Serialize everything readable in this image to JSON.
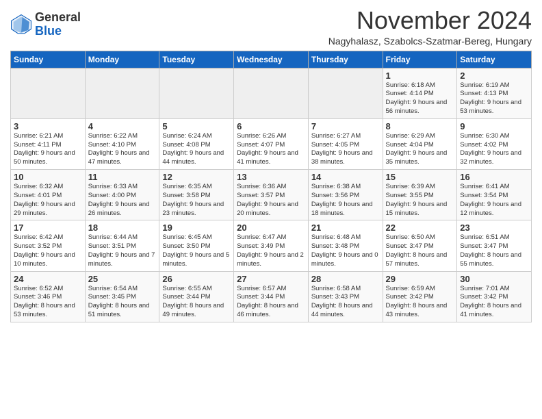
{
  "header": {
    "logo_general": "General",
    "logo_blue": "Blue",
    "month_title": "November 2024",
    "subtitle": "Nagyhalasz, Szabolcs-Szatmar-Bereg, Hungary"
  },
  "weekdays": [
    "Sunday",
    "Monday",
    "Tuesday",
    "Wednesday",
    "Thursday",
    "Friday",
    "Saturday"
  ],
  "weeks": [
    [
      {
        "day": "",
        "info": ""
      },
      {
        "day": "",
        "info": ""
      },
      {
        "day": "",
        "info": ""
      },
      {
        "day": "",
        "info": ""
      },
      {
        "day": "",
        "info": ""
      },
      {
        "day": "1",
        "info": "Sunrise: 6:18 AM\nSunset: 4:14 PM\nDaylight: 9 hours and 56 minutes."
      },
      {
        "day": "2",
        "info": "Sunrise: 6:19 AM\nSunset: 4:13 PM\nDaylight: 9 hours and 53 minutes."
      }
    ],
    [
      {
        "day": "3",
        "info": "Sunrise: 6:21 AM\nSunset: 4:11 PM\nDaylight: 9 hours and 50 minutes."
      },
      {
        "day": "4",
        "info": "Sunrise: 6:22 AM\nSunset: 4:10 PM\nDaylight: 9 hours and 47 minutes."
      },
      {
        "day": "5",
        "info": "Sunrise: 6:24 AM\nSunset: 4:08 PM\nDaylight: 9 hours and 44 minutes."
      },
      {
        "day": "6",
        "info": "Sunrise: 6:26 AM\nSunset: 4:07 PM\nDaylight: 9 hours and 41 minutes."
      },
      {
        "day": "7",
        "info": "Sunrise: 6:27 AM\nSunset: 4:05 PM\nDaylight: 9 hours and 38 minutes."
      },
      {
        "day": "8",
        "info": "Sunrise: 6:29 AM\nSunset: 4:04 PM\nDaylight: 9 hours and 35 minutes."
      },
      {
        "day": "9",
        "info": "Sunrise: 6:30 AM\nSunset: 4:02 PM\nDaylight: 9 hours and 32 minutes."
      }
    ],
    [
      {
        "day": "10",
        "info": "Sunrise: 6:32 AM\nSunset: 4:01 PM\nDaylight: 9 hours and 29 minutes."
      },
      {
        "day": "11",
        "info": "Sunrise: 6:33 AM\nSunset: 4:00 PM\nDaylight: 9 hours and 26 minutes."
      },
      {
        "day": "12",
        "info": "Sunrise: 6:35 AM\nSunset: 3:58 PM\nDaylight: 9 hours and 23 minutes."
      },
      {
        "day": "13",
        "info": "Sunrise: 6:36 AM\nSunset: 3:57 PM\nDaylight: 9 hours and 20 minutes."
      },
      {
        "day": "14",
        "info": "Sunrise: 6:38 AM\nSunset: 3:56 PM\nDaylight: 9 hours and 18 minutes."
      },
      {
        "day": "15",
        "info": "Sunrise: 6:39 AM\nSunset: 3:55 PM\nDaylight: 9 hours and 15 minutes."
      },
      {
        "day": "16",
        "info": "Sunrise: 6:41 AM\nSunset: 3:54 PM\nDaylight: 9 hours and 12 minutes."
      }
    ],
    [
      {
        "day": "17",
        "info": "Sunrise: 6:42 AM\nSunset: 3:52 PM\nDaylight: 9 hours and 10 minutes."
      },
      {
        "day": "18",
        "info": "Sunrise: 6:44 AM\nSunset: 3:51 PM\nDaylight: 9 hours and 7 minutes."
      },
      {
        "day": "19",
        "info": "Sunrise: 6:45 AM\nSunset: 3:50 PM\nDaylight: 9 hours and 5 minutes."
      },
      {
        "day": "20",
        "info": "Sunrise: 6:47 AM\nSunset: 3:49 PM\nDaylight: 9 hours and 2 minutes."
      },
      {
        "day": "21",
        "info": "Sunrise: 6:48 AM\nSunset: 3:48 PM\nDaylight: 9 hours and 0 minutes."
      },
      {
        "day": "22",
        "info": "Sunrise: 6:50 AM\nSunset: 3:47 PM\nDaylight: 8 hours and 57 minutes."
      },
      {
        "day": "23",
        "info": "Sunrise: 6:51 AM\nSunset: 3:47 PM\nDaylight: 8 hours and 55 minutes."
      }
    ],
    [
      {
        "day": "24",
        "info": "Sunrise: 6:52 AM\nSunset: 3:46 PM\nDaylight: 8 hours and 53 minutes."
      },
      {
        "day": "25",
        "info": "Sunrise: 6:54 AM\nSunset: 3:45 PM\nDaylight: 8 hours and 51 minutes."
      },
      {
        "day": "26",
        "info": "Sunrise: 6:55 AM\nSunset: 3:44 PM\nDaylight: 8 hours and 49 minutes."
      },
      {
        "day": "27",
        "info": "Sunrise: 6:57 AM\nSunset: 3:44 PM\nDaylight: 8 hours and 46 minutes."
      },
      {
        "day": "28",
        "info": "Sunrise: 6:58 AM\nSunset: 3:43 PM\nDaylight: 8 hours and 44 minutes."
      },
      {
        "day": "29",
        "info": "Sunrise: 6:59 AM\nSunset: 3:42 PM\nDaylight: 8 hours and 43 minutes."
      },
      {
        "day": "30",
        "info": "Sunrise: 7:01 AM\nSunset: 3:42 PM\nDaylight: 8 hours and 41 minutes."
      }
    ]
  ]
}
